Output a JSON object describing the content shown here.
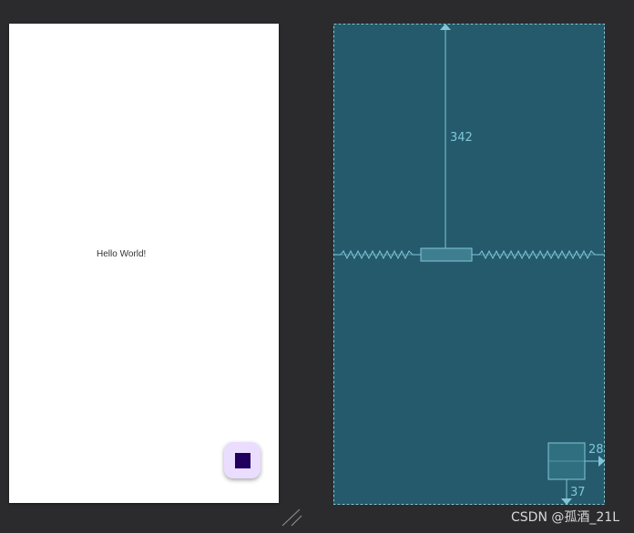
{
  "design": {
    "hello_text": "Hello World!",
    "fab_icon": "stop-square-icon"
  },
  "blueprint": {
    "margin_top": "342",
    "margin_right": "28",
    "margin_bottom": "37"
  },
  "watermark": "CSDN @孤酒_21L",
  "colors": {
    "canvas_bg": "#2b2b2d",
    "blueprint_bg": "#245a6c",
    "blueprint_line": "#7fc6d8",
    "fab_bg": "#eaddff",
    "fab_icon": "#21005d"
  }
}
